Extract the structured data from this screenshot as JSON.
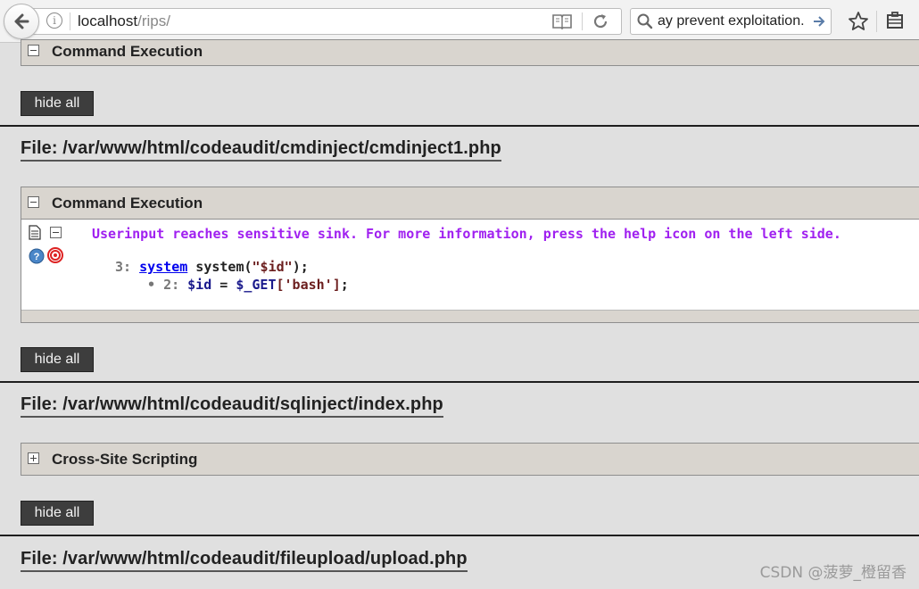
{
  "browser": {
    "url_host": "localhost",
    "url_path": "/rips/",
    "search_text": "ay prevent exploitation."
  },
  "sections": {
    "top_panel_title": "Command Execution",
    "hide_all_label": "hide all",
    "file1": "File: /var/www/html/codeaudit/cmdinject/cmdinject1.php",
    "file1_panel_title": "Command Execution",
    "file2": "File: /var/www/html/codeaudit/sqlinject/index.php",
    "file2_panel_title": "Cross-Site Scripting",
    "file3": "File: /var/www/html/codeaudit/fileupload/upload.php"
  },
  "result": {
    "message": "Userinput reaches sensitive sink. For more information, press the help icon on the left side.",
    "line1_num": "3:",
    "line1_link": "system",
    "line1_code_pre": " system(",
    "line1_str": "\"$id\"",
    "line1_code_post": ");",
    "line2_num": "2:",
    "line2_var": "$id",
    "line2_eq": " = ",
    "line2_get": "$_GET",
    "line2_key": "['bash']",
    "line2_end": ";"
  },
  "watermark": "CSDN @菠萝_橙留香"
}
